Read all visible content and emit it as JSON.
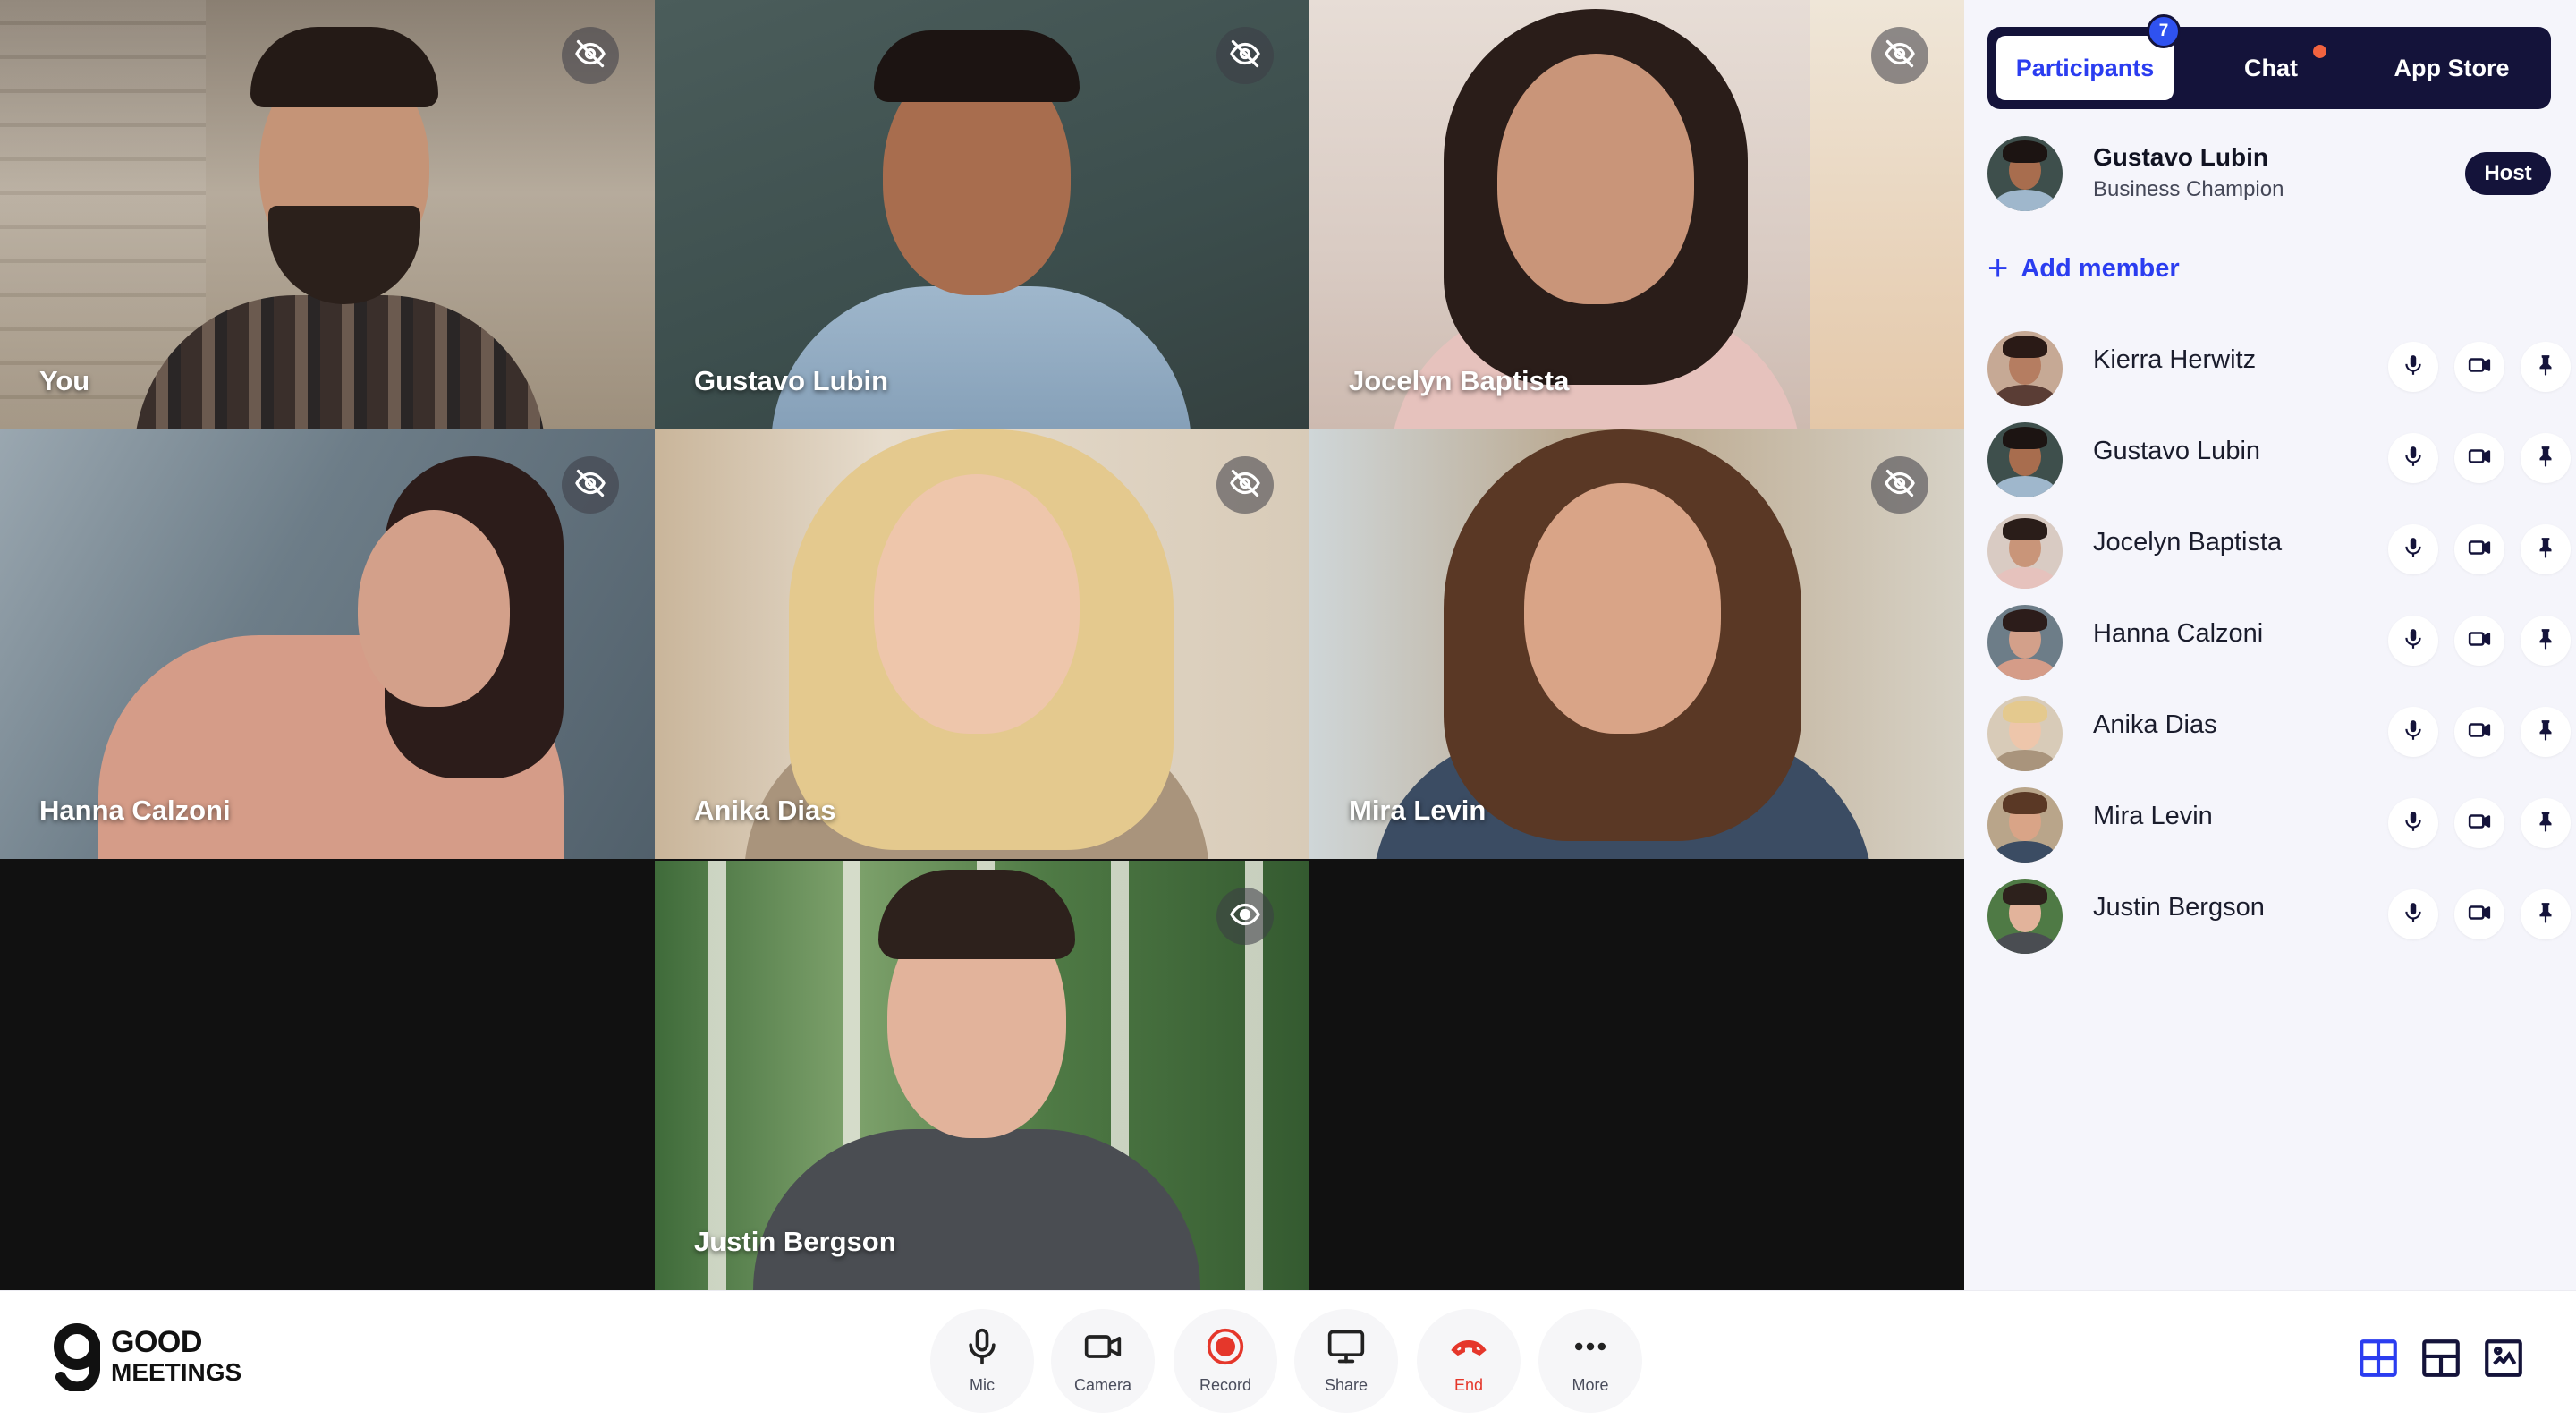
{
  "app": {
    "logo_line1": "GOOD",
    "logo_line2": "MEETINGS"
  },
  "tiles": [
    {
      "name": "You",
      "visibility_icon": "eye-off-icon"
    },
    {
      "name": "Gustavo Lubin",
      "visibility_icon": "eye-off-icon"
    },
    {
      "name": "Jocelyn Baptista",
      "visibility_icon": "eye-off-icon"
    },
    {
      "name": "Hanna Calzoni",
      "visibility_icon": "eye-off-icon"
    },
    {
      "name": "Anika Dias",
      "visibility_icon": "eye-off-icon"
    },
    {
      "name": "Mira Levin",
      "visibility_icon": "eye-off-icon"
    },
    {
      "name": "Justin Bergson",
      "visibility_icon": "eye-icon"
    }
  ],
  "panel": {
    "tabs": [
      {
        "label": "Participants",
        "badge": "7",
        "active": true
      },
      {
        "label": "Chat",
        "unread_dot": true
      },
      {
        "label": "App Store"
      }
    ],
    "host": {
      "name": "Gustavo Lubin",
      "role": "Business Champion",
      "badge": "Host"
    },
    "add_member": "Add member",
    "participants": [
      {
        "name": "Kierra Herwitz"
      },
      {
        "name": "Gustavo Lubin"
      },
      {
        "name": "Jocelyn Baptista"
      },
      {
        "name": "Hanna Calzoni"
      },
      {
        "name": "Anika Dias"
      },
      {
        "name": "Mira Levin"
      },
      {
        "name": "Justin Bergson"
      }
    ]
  },
  "controls": [
    {
      "label": "Mic",
      "icon": "mic-icon"
    },
    {
      "label": "Camera",
      "icon": "camera-icon"
    },
    {
      "label": "Record",
      "icon": "record-icon"
    },
    {
      "label": "Share",
      "icon": "screen-share-icon"
    },
    {
      "label": "End",
      "icon": "phone-hangup-icon"
    },
    {
      "label": "More",
      "icon": "more-dots-icon"
    }
  ],
  "layout_buttons": [
    "grid-layout-icon",
    "speaker-layout-icon",
    "fullscreen-layout-icon"
  ],
  "colors": {
    "accent": "#2b3df0",
    "navy": "#14133a",
    "end_red": "#e5372b",
    "panel_bg": "#f5f5fb"
  }
}
